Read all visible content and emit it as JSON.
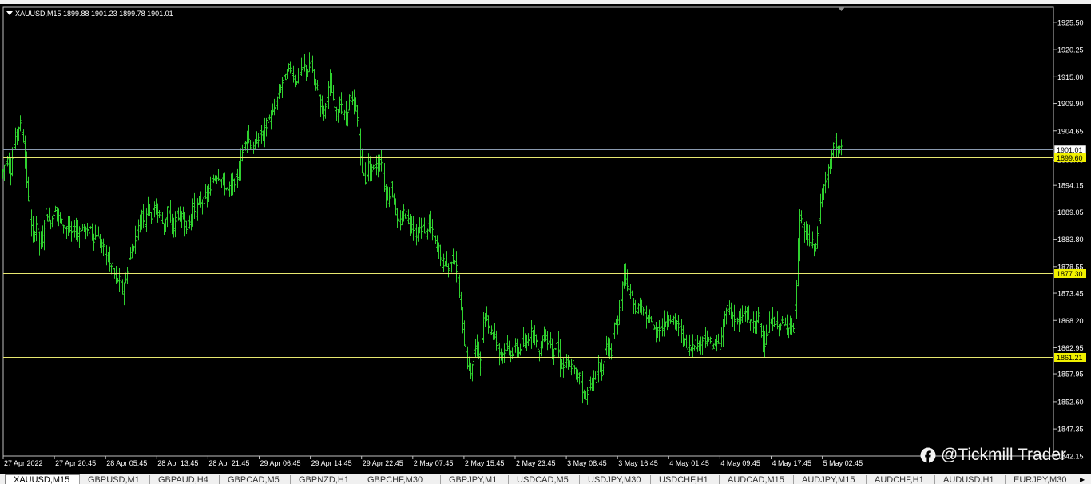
{
  "window": {
    "symbol_label": "XAUUSD,M15  1899.88 1901.23 1899.78 1901.01"
  },
  "chart_data": {
    "type": "bar",
    "symbol": "XAUUSD",
    "timeframe": "M15",
    "ohlc_header": {
      "open": 1899.88,
      "high": 1901.23,
      "low": 1899.78,
      "close": 1901.01
    },
    "ylim": [
      1842.15,
      1928.4
    ],
    "y_ticks": [
      "1925.50",
      "1920.25",
      "1915.00",
      "1909.90",
      "1904.65",
      "1899.05",
      "1894.15",
      "1889.05",
      "1883.80",
      "1878.55",
      "1873.45",
      "1868.20",
      "1862.95",
      "1857.95",
      "1852.60",
      "1847.35",
      "1842.15"
    ],
    "x_ticks": [
      "27 Apr 2022",
      "27 Apr 20:45",
      "28 Apr 05:45",
      "28 Apr 13:45",
      "28 Apr 21:45",
      "29 Apr 06:45",
      "29 Apr 14:45",
      "29 Apr 22:45",
      "2 May 07:45",
      "2 May 15:45",
      "2 May 23:45",
      "3 May 08:45",
      "3 May 16:45",
      "4 May 01:45",
      "4 May 09:45",
      "4 May 17:45",
      "5 May 02:45"
    ],
    "price_levels": [
      {
        "label": "1901.01",
        "value": 1901.01,
        "kind": "bid",
        "color": "#8a9ab0"
      },
      {
        "label": "1899.60",
        "value": 1899.6,
        "kind": "horizontal-line",
        "color": "#e8e870"
      },
      {
        "label": "1877.30",
        "value": 1877.3,
        "kind": "horizontal-line",
        "color": "#e8e870"
      },
      {
        "label": "1861.21",
        "value": 1861.21,
        "kind": "horizontal-line",
        "color": "#e8e870"
      }
    ],
    "series": [
      {
        "color": "#2fd12f",
        "close_path": [
          [
            0,
            1896
          ],
          [
            4,
            1898
          ],
          [
            8,
            1899
          ],
          [
            12,
            1897
          ],
          [
            16,
            1902
          ],
          [
            20,
            1905
          ],
          [
            24,
            1906
          ],
          [
            28,
            1903
          ],
          [
            32,
            1895
          ],
          [
            36,
            1888
          ],
          [
            40,
            1884
          ],
          [
            44,
            1887
          ],
          [
            48,
            1883
          ],
          [
            52,
            1884
          ],
          [
            56,
            1889
          ],
          [
            60,
            1887
          ],
          [
            64,
            1888
          ],
          [
            68,
            1890
          ],
          [
            72,
            1888
          ],
          [
            76,
            1887
          ],
          [
            80,
            1886
          ],
          [
            84,
            1886
          ],
          [
            88,
            1885
          ],
          [
            92,
            1886
          ],
          [
            96,
            1885
          ],
          [
            100,
            1886
          ],
          [
            104,
            1886
          ],
          [
            108,
            1885
          ],
          [
            112,
            1886
          ],
          [
            116,
            1884
          ],
          [
            120,
            1885
          ],
          [
            124,
            1883
          ],
          [
            128,
            1882
          ],
          [
            132,
            1881
          ],
          [
            136,
            1879
          ],
          [
            140,
            1878
          ],
          [
            144,
            1876
          ],
          [
            148,
            1876
          ],
          [
            152,
            1874
          ],
          [
            156,
            1876
          ],
          [
            160,
            1880
          ],
          [
            164,
            1882
          ],
          [
            168,
            1884
          ],
          [
            172,
            1886
          ],
          [
            176,
            1889
          ],
          [
            180,
            1887
          ],
          [
            184,
            1891
          ],
          [
            188,
            1888
          ],
          [
            192,
            1890
          ],
          [
            196,
            1889
          ],
          [
            200,
            1888
          ],
          [
            204,
            1886
          ],
          [
            208,
            1890
          ],
          [
            212,
            1887
          ],
          [
            216,
            1886
          ],
          [
            220,
            1889
          ],
          [
            224,
            1888
          ],
          [
            228,
            1888
          ],
          [
            232,
            1886
          ],
          [
            236,
            1887
          ],
          [
            240,
            1890
          ],
          [
            244,
            1889
          ],
          [
            248,
            1891
          ],
          [
            252,
            1891
          ],
          [
            256,
            1892
          ],
          [
            260,
            1893
          ],
          [
            264,
            1895
          ],
          [
            268,
            1896
          ],
          [
            272,
            1896
          ],
          [
            276,
            1895
          ],
          [
            280,
            1894
          ],
          [
            284,
            1893
          ],
          [
            288,
            1894
          ],
          [
            292,
            1895
          ],
          [
            296,
            1896
          ],
          [
            300,
            1899
          ],
          [
            304,
            1902
          ],
          [
            308,
            1904
          ],
          [
            312,
            1902
          ],
          [
            316,
            1901
          ],
          [
            320,
            1903
          ],
          [
            324,
            1904
          ],
          [
            328,
            1904
          ],
          [
            332,
            1906
          ],
          [
            336,
            1907
          ],
          [
            340,
            1908
          ],
          [
            344,
            1910
          ],
          [
            348,
            1912
          ],
          [
            352,
            1914
          ],
          [
            356,
            1915
          ],
          [
            360,
            1917
          ],
          [
            364,
            1916
          ],
          [
            368,
            1914
          ],
          [
            372,
            1915
          ],
          [
            376,
            1916
          ],
          [
            380,
            1917
          ],
          [
            384,
            1916
          ],
          [
            388,
            1918
          ],
          [
            392,
            1914
          ],
          [
            396,
            1913
          ],
          [
            400,
            1910
          ],
          [
            404,
            1908
          ],
          [
            408,
            1911
          ],
          [
            412,
            1914
          ],
          [
            416,
            1910
          ],
          [
            420,
            1908
          ],
          [
            424,
            1910
          ],
          [
            428,
            1908
          ],
          [
            432,
            1907
          ],
          [
            436,
            1911
          ],
          [
            440,
            1910
          ],
          [
            444,
            1909
          ],
          [
            448,
            1904
          ],
          [
            452,
            1897
          ],
          [
            456,
            1895
          ],
          [
            460,
            1898
          ],
          [
            464,
            1897
          ],
          [
            468,
            1898
          ],
          [
            472,
            1898
          ],
          [
            476,
            1899
          ],
          [
            480,
            1894
          ],
          [
            484,
            1891
          ],
          [
            488,
            1894
          ],
          [
            492,
            1891
          ],
          [
            496,
            1887
          ],
          [
            500,
            1887
          ],
          [
            504,
            1889
          ],
          [
            508,
            1888
          ],
          [
            512,
            1887
          ],
          [
            516,
            1886
          ],
          [
            520,
            1884
          ],
          [
            524,
            1886
          ],
          [
            528,
            1886
          ],
          [
            532,
            1885
          ],
          [
            536,
            1887
          ],
          [
            540,
            1885
          ],
          [
            544,
            1883
          ],
          [
            548,
            1882
          ],
          [
            552,
            1879
          ],
          [
            556,
            1880
          ],
          [
            560,
            1878
          ],
          [
            564,
            1880
          ],
          [
            568,
            1880
          ],
          [
            572,
            1876
          ],
          [
            576,
            1870
          ],
          [
            580,
            1864
          ],
          [
            584,
            1860
          ],
          [
            588,
            1858
          ],
          [
            592,
            1862
          ],
          [
            596,
            1864
          ],
          [
            600,
            1860
          ],
          [
            604,
            1868
          ],
          [
            608,
            1869
          ],
          [
            612,
            1866
          ],
          [
            616,
            1866
          ],
          [
            620,
            1864
          ],
          [
            624,
            1862
          ],
          [
            628,
            1862
          ],
          [
            632,
            1863
          ],
          [
            636,
            1862
          ],
          [
            640,
            1862
          ],
          [
            644,
            1863
          ],
          [
            648,
            1862
          ],
          [
            652,
            1864
          ],
          [
            656,
            1863
          ],
          [
            660,
            1865
          ],
          [
            664,
            1866
          ],
          [
            668,
            1866
          ],
          [
            672,
            1862
          ],
          [
            676,
            1863
          ],
          [
            680,
            1866
          ],
          [
            684,
            1864
          ],
          [
            688,
            1864
          ],
          [
            692,
            1862
          ],
          [
            696,
            1864
          ],
          [
            700,
            1860
          ],
          [
            704,
            1859
          ],
          [
            708,
            1860
          ],
          [
            712,
            1859
          ],
          [
            716,
            1860
          ],
          [
            720,
            1857
          ],
          [
            724,
            1858
          ],
          [
            728,
            1855
          ],
          [
            732,
            1853
          ],
          [
            736,
            1856
          ],
          [
            740,
            1856
          ],
          [
            744,
            1857
          ],
          [
            748,
            1860
          ],
          [
            752,
            1858
          ],
          [
            756,
            1862
          ],
          [
            760,
            1864
          ],
          [
            764,
            1862
          ],
          [
            768,
            1868
          ],
          [
            772,
            1868
          ],
          [
            776,
            1872
          ],
          [
            780,
            1878
          ],
          [
            784,
            1874
          ],
          [
            788,
            1874
          ],
          [
            792,
            1871
          ],
          [
            796,
            1870
          ],
          [
            800,
            1871
          ],
          [
            804,
            1870
          ],
          [
            808,
            1868
          ],
          [
            812,
            1869
          ],
          [
            816,
            1867
          ],
          [
            820,
            1866
          ],
          [
            824,
            1867
          ],
          [
            828,
            1867
          ],
          [
            832,
            1868
          ],
          [
            836,
            1869
          ],
          [
            840,
            1868
          ],
          [
            844,
            1868
          ],
          [
            848,
            1867
          ],
          [
            852,
            1866
          ],
          [
            856,
            1864
          ],
          [
            860,
            1863
          ],
          [
            864,
            1863
          ],
          [
            868,
            1864
          ],
          [
            872,
            1863
          ],
          [
            876,
            1864
          ],
          [
            880,
            1865
          ],
          [
            884,
            1864
          ],
          [
            888,
            1864
          ],
          [
            892,
            1863
          ],
          [
            896,
            1864
          ],
          [
            900,
            1863
          ],
          [
            904,
            1867
          ],
          [
            908,
            1871
          ],
          [
            912,
            1870
          ],
          [
            916,
            1869
          ],
          [
            920,
            1868
          ],
          [
            924,
            1868
          ],
          [
            928,
            1869
          ],
          [
            932,
            1870
          ],
          [
            936,
            1868
          ],
          [
            940,
            1868
          ],
          [
            944,
            1867
          ],
          [
            948,
            1869
          ],
          [
            952,
            1866
          ],
          [
            956,
            1864
          ],
          [
            960,
            1866
          ],
          [
            964,
            1868
          ],
          [
            968,
            1868
          ],
          [
            972,
            1867
          ],
          [
            976,
            1868
          ],
          [
            980,
            1867
          ],
          [
            984,
            1867
          ],
          [
            988,
            1868
          ],
          [
            992,
            1866
          ],
          [
            996,
            1875
          ],
          [
            1000,
            1888
          ],
          [
            1004,
            1886
          ],
          [
            1008,
            1885
          ],
          [
            1012,
            1883
          ],
          [
            1016,
            1883
          ],
          [
            1020,
            1882
          ],
          [
            1024,
            1888
          ],
          [
            1028,
            1893
          ],
          [
            1032,
            1895
          ],
          [
            1036,
            1897
          ],
          [
            1040,
            1900
          ],
          [
            1044,
            1903
          ],
          [
            1048,
            1901
          ],
          [
            1052,
            1901
          ]
        ]
      }
    ]
  },
  "tabs": [
    {
      "label": "XAUUSD,M15",
      "active": true
    },
    {
      "label": "GBPUSD,M1"
    },
    {
      "label": "GBPAUD,H4"
    },
    {
      "label": "GBPCAD,M5"
    },
    {
      "label": "GBPNZD,H1"
    },
    {
      "label": "GBPCHF,M30"
    },
    {
      "label": "GBPJPY,M1"
    },
    {
      "label": "USDCAD,M5"
    },
    {
      "label": "USDJPY,M30"
    },
    {
      "label": "USDCHF,H1"
    },
    {
      "label": "AUDCAD,M15"
    },
    {
      "label": "AUDJPY,M15"
    },
    {
      "label": "AUDCHF,H1"
    },
    {
      "label": "AUDUSD,H1"
    },
    {
      "label": "EURJPY,M30"
    }
  ],
  "watermark": {
    "text": "@Tickmill Trader",
    "icon": "facebook-icon"
  }
}
